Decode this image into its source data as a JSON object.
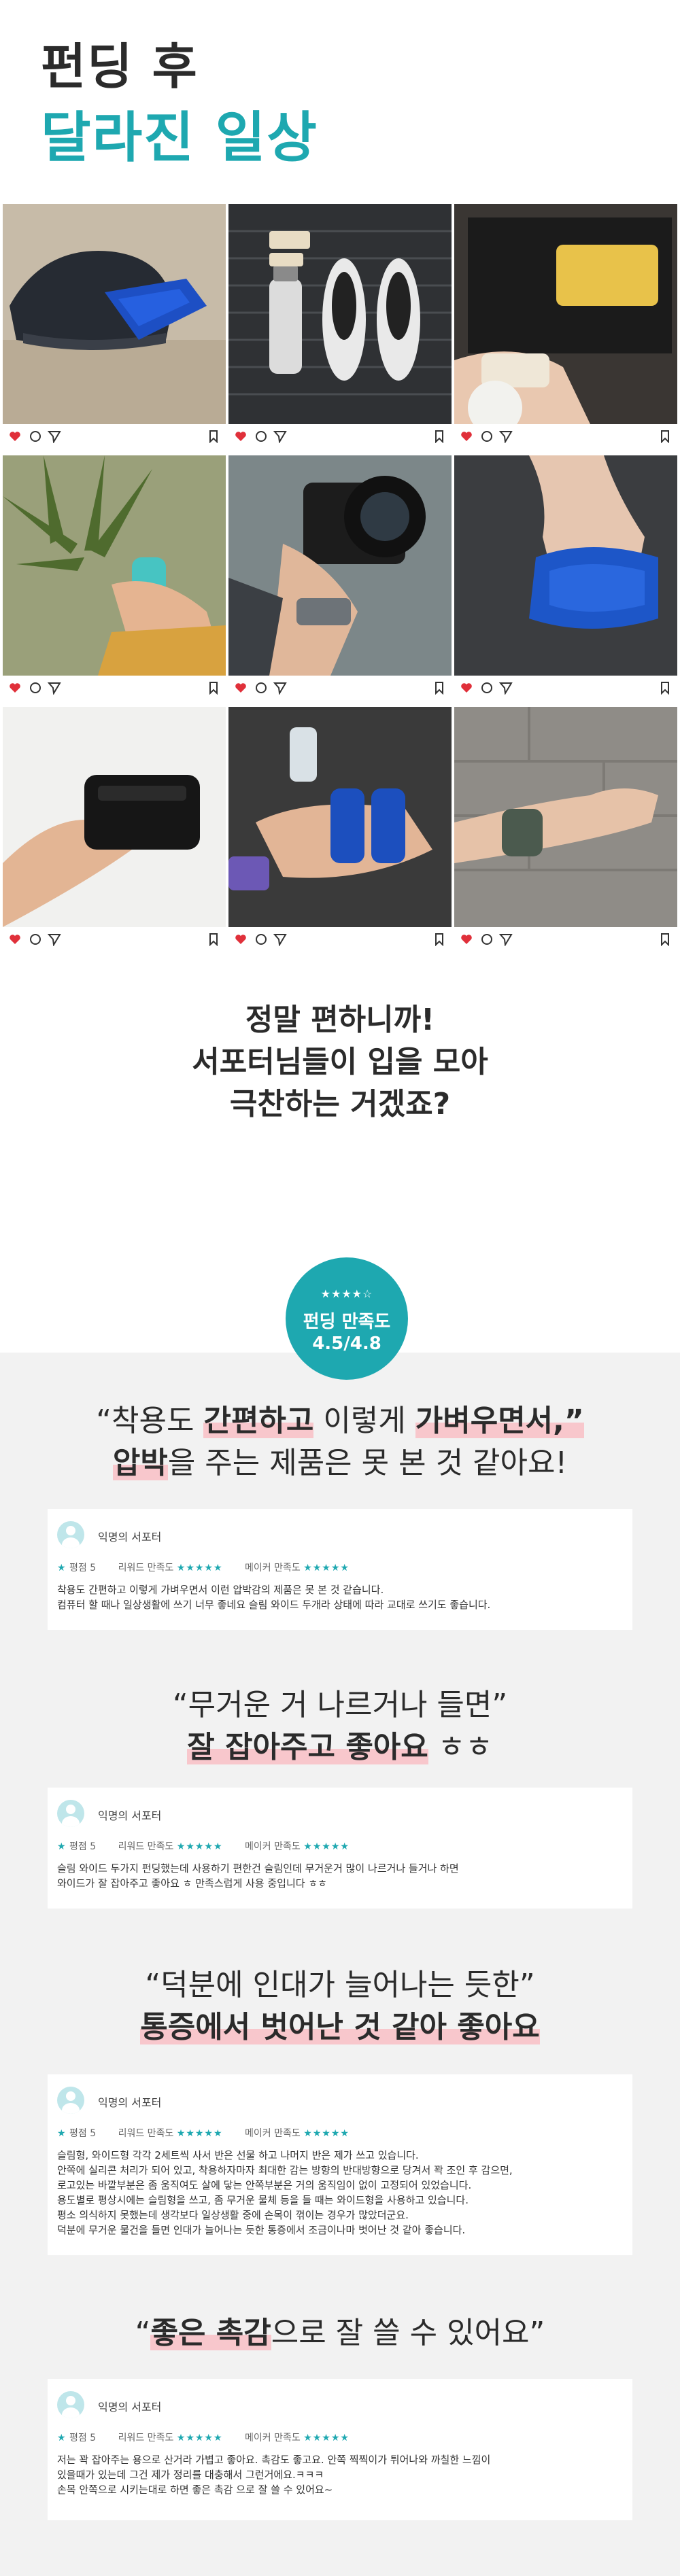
{
  "hero": {
    "title_line1": "펀딩 후",
    "title_line2": "달라진 일상"
  },
  "photo_grid": {
    "tiles": [
      {
        "icons": [
          "heart-icon",
          "comment-icon",
          "send-icon",
          "bookmark-icon"
        ]
      },
      {
        "icons": [
          "heart-icon",
          "comment-icon",
          "send-icon",
          "bookmark-icon"
        ]
      },
      {
        "icons": [
          "heart-icon",
          "comment-icon",
          "send-icon",
          "bookmark-icon"
        ]
      },
      {
        "icons": [
          "heart-icon",
          "comment-icon",
          "send-icon",
          "bookmark-icon"
        ]
      },
      {
        "icons": [
          "heart-icon",
          "comment-icon",
          "send-icon",
          "bookmark-icon"
        ]
      },
      {
        "icons": [
          "heart-icon",
          "comment-icon",
          "send-icon",
          "bookmark-icon"
        ]
      },
      {
        "icons": [
          "heart-icon",
          "comment-icon",
          "send-icon",
          "bookmark-icon"
        ]
      },
      {
        "icons": [
          "heart-icon",
          "comment-icon",
          "send-icon",
          "bookmark-icon"
        ]
      },
      {
        "icons": [
          "heart-icon",
          "comment-icon",
          "send-icon",
          "bookmark-icon"
        ]
      }
    ],
    "heart_color": "#e0303a"
  },
  "heading": {
    "line1": "정말 편하니까!",
    "line2": "서포터님들이 입을 모아",
    "line3": "극찬하는 거겠죠?"
  },
  "badge": {
    "stars": "★★★★☆",
    "label": "펀딩 만족도",
    "score": "4.5/4.8",
    "color": "#1ea8b0"
  },
  "reviews": [
    {
      "quote_parts": [
        "“착용도 ",
        "간편하고",
        " 이렇게 ",
        "가벼우면서,”",
        "압박",
        "을 주는 제품은 못 본 것 같아요!"
      ],
      "author": "익명의 서포터",
      "rating_label": "평점 5",
      "reward_label": "리워드 만족도",
      "maker_label": "메이커 만족도",
      "stars": "★★★★★",
      "body_lines": [
        "착용도 간편하고 이렇게 가벼우면서 이런 압박감의 제품은 못 본 것 같습니다.",
        "컴퓨터 할 때나 일상생활에 쓰기 너무 좋네요 슬림 와이드 두개라 상태에 따라 교대로 쓰기도 좋습니다."
      ]
    },
    {
      "quote_parts": [
        "“무거운 거 나르거나 들면”",
        "잘 잡아주고 좋아요",
        " ㅎㅎ"
      ],
      "author": "익명의 서포터",
      "rating_label": "평점 5",
      "reward_label": "리워드 만족도",
      "maker_label": "메이커 만족도",
      "stars": "★★★★★",
      "body_lines": [
        "슬림 와이드 두가지 펀딩했는데 사용하기 편한건 슬림인데 무거운거 많이 나르거나 들거나 하면",
        "와이드가 잘 잡아주고 좋아요 ㅎ 만족스럽게 사용 중입니다 ㅎㅎ"
      ]
    },
    {
      "quote_parts": [
        "“덕분에 인대가 늘어나는 듯한”",
        "통증에서 벗어난 것 같아 좋아요"
      ],
      "author": "익명의 서포터",
      "rating_label": "평점 5",
      "reward_label": "리워드 만족도",
      "maker_label": "메이커 만족도",
      "stars": "★★★★★",
      "body_lines": [
        "슬림형, 와이드형 각각 2세트씩 사서 반은 선물 하고 나머지 반은 제가 쓰고 있습니다.",
        "안쪽에 실리콘 처리가 되어 있고, 착용하자마자 최대한 감는 방향의 반대방향으로 당겨서 꽉 조인 후 감으면,",
        "로고있는 바깥부분은 좀 움직여도 살에 닿는 안쪽부분은 거의 움직임이 없이 고정되어 있었습니다.",
        "용도별로 평상시에는 슬림형을 쓰고, 좀 무거운 물체 등을 들 때는 와이드형을 사용하고 있습니다.",
        "평소 의식하지 못했는데 생각보다 일상생활 중에 손목이 꺾이는 경우가 많았더군요.",
        "덕분에 무거운 물건을 들면 인대가 늘어나는 듯한 통증에서 조금이나마 벗어난 것 같아 좋습니다."
      ]
    },
    {
      "quote_parts": [
        "“",
        "좋은 촉감",
        "으로 잘 쓸 수 있어요”"
      ],
      "author": "익명의 서포터",
      "rating_label": "평점 5",
      "reward_label": "리워드 만족도",
      "maker_label": "메이커 만족도",
      "stars": "★★★★★",
      "body_lines": [
        "저는 꽉 잡아주는 용으로 산거라 가볍고 좋아요. 촉감도 좋고요. 안쪽 찍찍이가 튀어나와 까칠한 느낌이",
        "있을때가 있는데 그건 제가 정리를 대충해서 그런거에요.ㅋㅋㅋ",
        "손목 안쪽으로 시키는대로 하면 좋은 촉감 으로 잘 쓸 수 있어요~"
      ]
    }
  ]
}
